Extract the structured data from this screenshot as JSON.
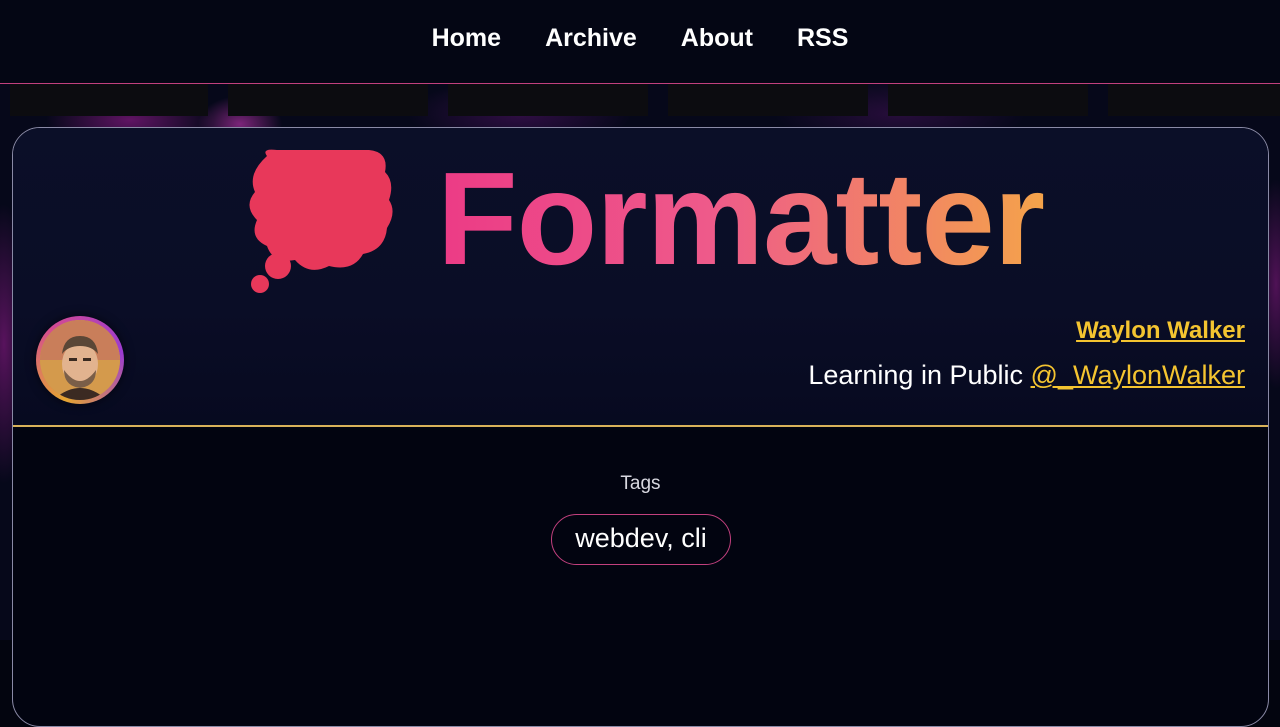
{
  "nav": {
    "items": [
      {
        "label": "Home"
      },
      {
        "label": "Archive"
      },
      {
        "label": "About"
      },
      {
        "label": "RSS"
      }
    ]
  },
  "post": {
    "title": "Formatter",
    "icon": "thought-bubble-icon"
  },
  "author": {
    "name": "Waylon Walker",
    "tagline": "Learning in Public",
    "handle": "@_WaylonWalker"
  },
  "tags": {
    "label": "Tags",
    "value": "webdev, cli"
  },
  "colors": {
    "background": "#03050f",
    "nav_border": "#c2407e",
    "link": "#f4c430",
    "title_gradient_start": "#ec3b86",
    "title_gradient_end": "#f4a34a",
    "hero_divider": "#d9b25a",
    "icon_fill": "#e8385a"
  }
}
